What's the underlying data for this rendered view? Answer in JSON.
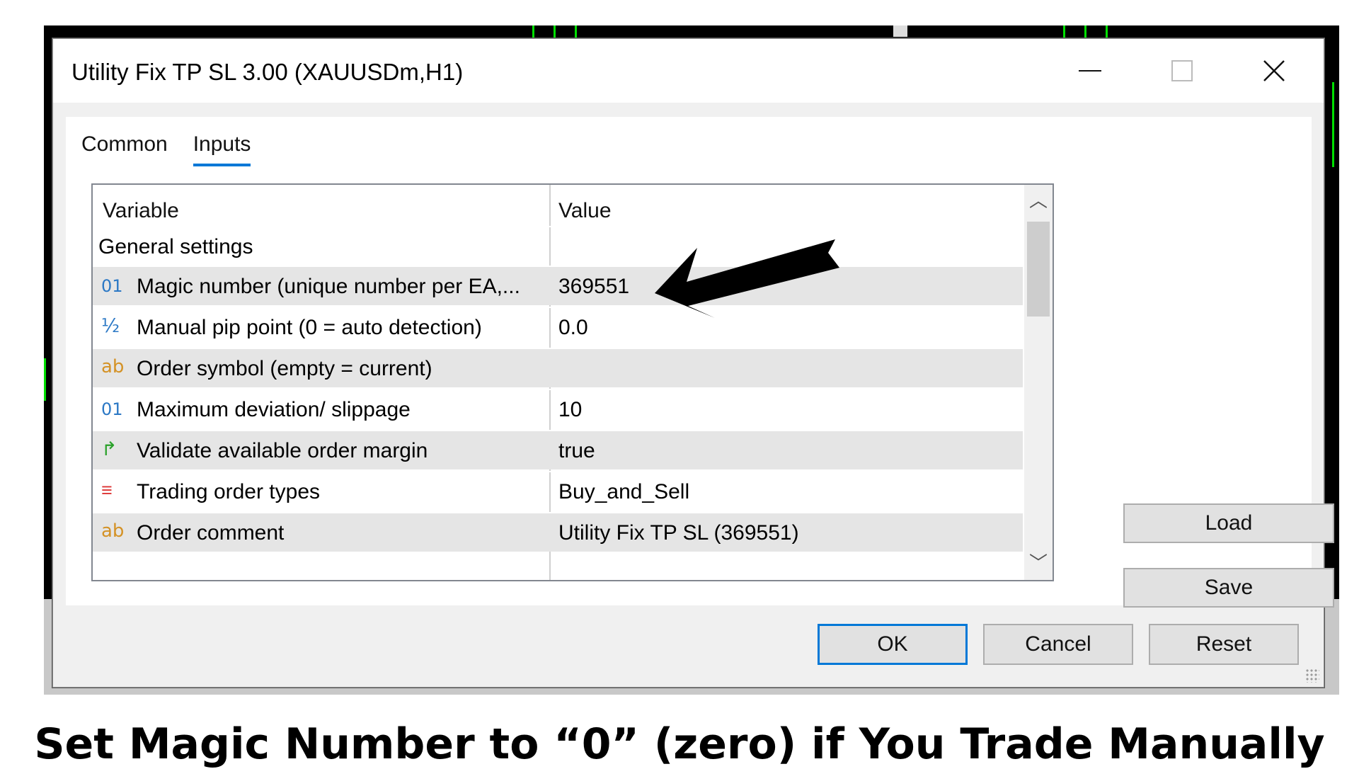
{
  "window": {
    "title": "Utility Fix TP SL 3.00 (XAUUSDm,H1)"
  },
  "tabs": [
    {
      "label": "Common",
      "active": false
    },
    {
      "label": "Inputs",
      "active": true
    }
  ],
  "grid": {
    "headers": {
      "variable": "Variable",
      "value": "Value"
    },
    "group": "General settings",
    "rows": [
      {
        "icon": "integer-icon",
        "icon_text": "01",
        "name": "Magic number (unique number per EA,...",
        "value": "369551"
      },
      {
        "icon": "double-icon",
        "icon_text": "½",
        "name": "Manual pip point (0 = auto detection)",
        "value": "0.0"
      },
      {
        "icon": "string-icon",
        "icon_text": "ab",
        "name": "Order symbol (empty = current)",
        "value": ""
      },
      {
        "icon": "integer-icon",
        "icon_text": "01",
        "name": "Maximum deviation/ slippage",
        "value": "10"
      },
      {
        "icon": "bool-icon",
        "icon_text": "↱",
        "name": "Validate available order margin",
        "value": "true"
      },
      {
        "icon": "enum-icon",
        "icon_text": "≡",
        "name": "Trading order types",
        "value": "Buy_and_Sell"
      },
      {
        "icon": "string-icon",
        "icon_text": "ab",
        "name": "Order comment",
        "value": "Utility Fix TP SL (369551)"
      }
    ]
  },
  "side_buttons": {
    "load": "Load",
    "save": "Save"
  },
  "bottom_buttons": {
    "ok": "OK",
    "cancel": "Cancel",
    "reset": "Reset"
  },
  "caption": "Set Magic Number to “0” (zero) if You Trade Manually",
  "colors": {
    "accent": "#0078d7",
    "chart_green": "#00e000"
  }
}
